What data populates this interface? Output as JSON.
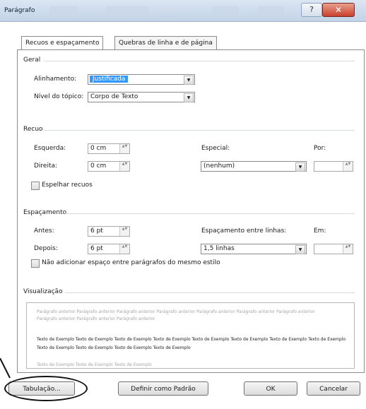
{
  "window": {
    "title": "Parágrafo",
    "close_symbol": "✕",
    "help_symbol": "?"
  },
  "tabs": [
    {
      "label": "Recuos e espaçamento"
    },
    {
      "label": "Quebras de linha e de página"
    }
  ],
  "geral": {
    "heading": "Geral",
    "alinhamento_label": "Alinhamento:",
    "alinhamento_value": "Justificada",
    "nivel_label": "Nível do tópico:",
    "nivel_value": "Corpo de Texto"
  },
  "recuo": {
    "heading": "Recuo",
    "esquerda_label": "Esquerda:",
    "esquerda_value": "0 cm",
    "direita_label": "Direita:",
    "direita_value": "0 cm",
    "especial_label": "Especial:",
    "especial_value": "(nenhum)",
    "por_label": "Por:",
    "por_value": "",
    "espelhar_label": "Espelhar recuos"
  },
  "espacamento": {
    "heading": "Espaçamento",
    "antes_label": "Antes:",
    "antes_value": "6 pt",
    "depois_label": "Depois:",
    "depois_value": "6 pt",
    "entre_linhas_label": "Espaçamento entre linhas:",
    "entre_linhas_value": "1,5 linhas",
    "em_label": "Em:",
    "em_value": "",
    "nao_adicionar_label": "Não adicionar espaço entre parágrafos do mesmo estilo"
  },
  "visualizacao": {
    "heading": "Visualização",
    "previous_text": "Parágrafo anterior Parágrafo anterior Parágrafo anterior Parágrafo anterior Parágrafo anterior Parágrafo anterior Parágrafo anterior Parágrafo anterior Parágrafo anterior Parágrafo anterior",
    "sample_text": "Texto de Exemplo Texto de Exemplo Texto de Exemplo Texto de Exemplo Texto de Exemplo Texto de Exemplo Texto de Exemplo Texto de Exemplo Texto de Exemplo Texto de Exemplo Texto de Exemplo Texto de Exemplo",
    "next_text": "Texto de Exemplo Texto de Exemplo Texto de Exemplo"
  },
  "buttons": {
    "tabulacao": "Tabulação...",
    "definir_padrao": "Definir como Padrão",
    "ok": "OK",
    "cancelar": "Cancelar"
  },
  "icons": {
    "dropdown": "▼",
    "spinner": "▲▼"
  },
  "colors": {
    "selection": "#3399ff",
    "close_button": "#c8402d",
    "titlebar": "#c3d3e7"
  }
}
